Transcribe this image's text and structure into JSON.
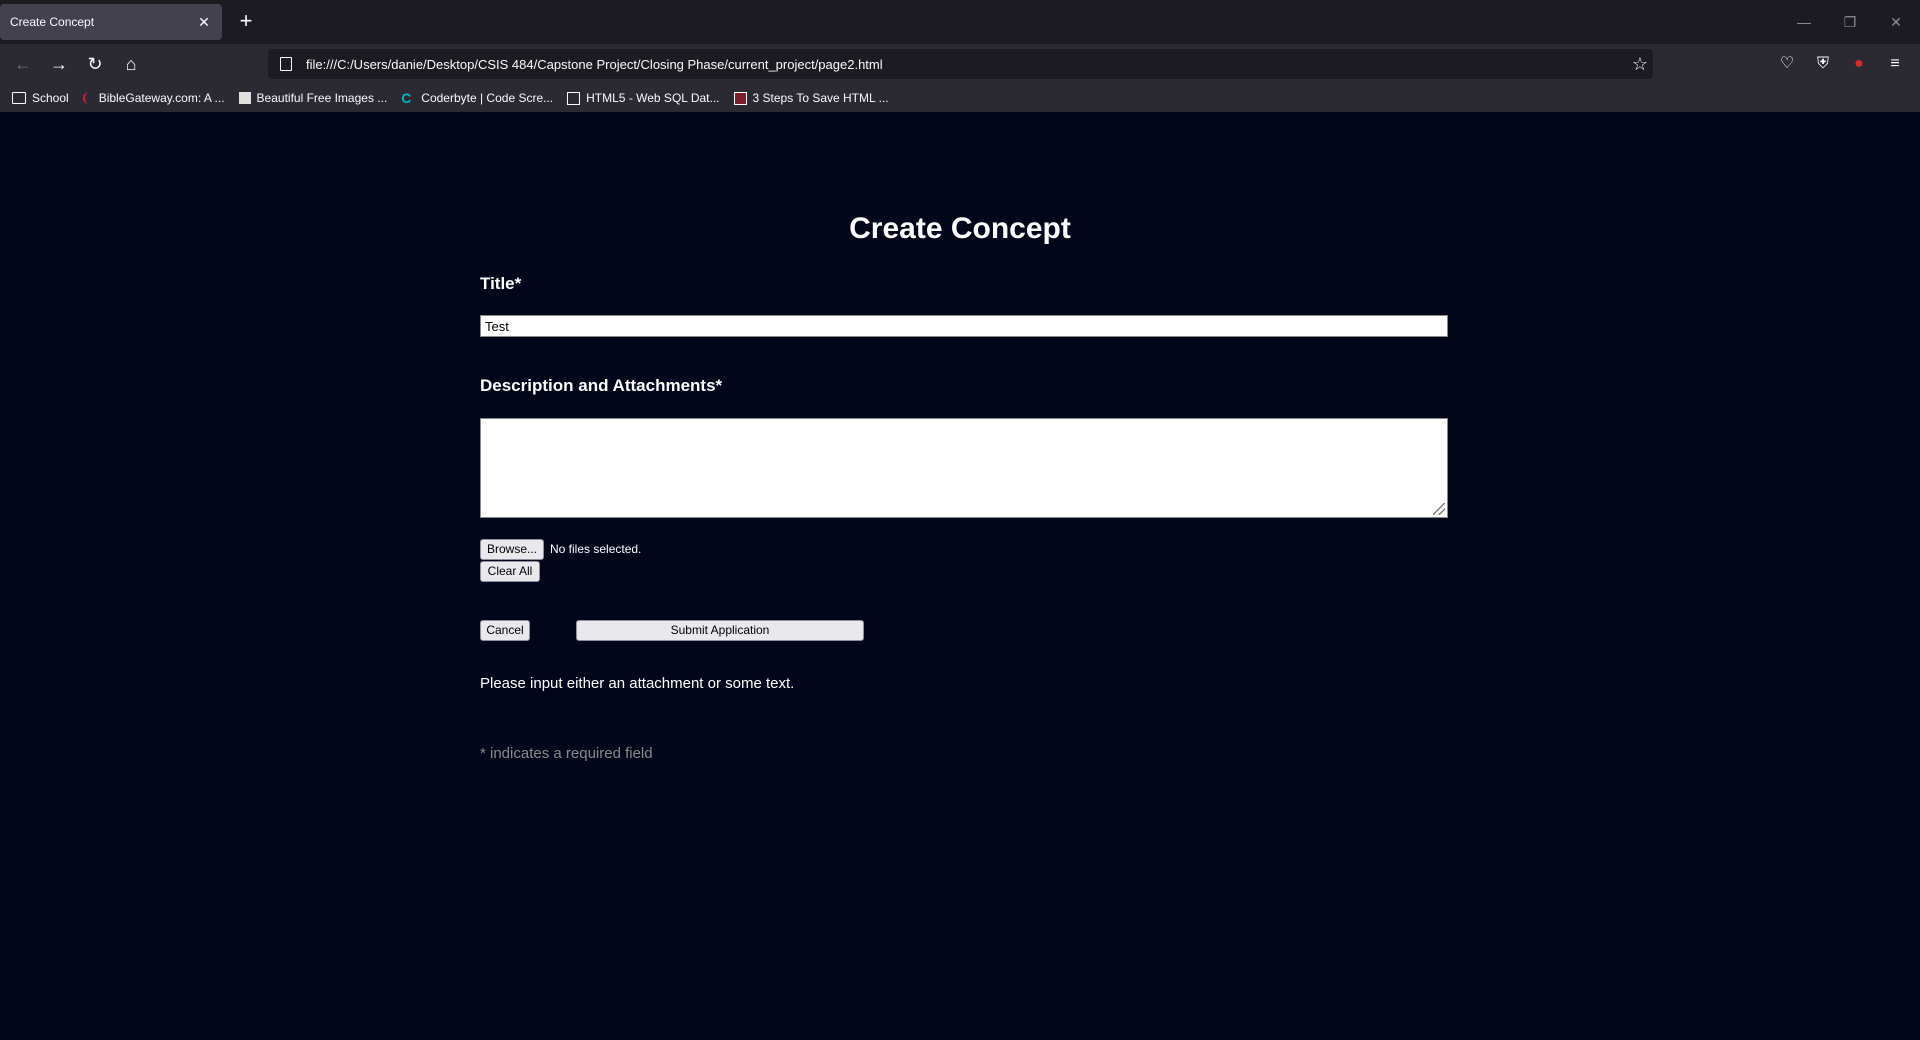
{
  "browser": {
    "tab_title": "Create Concept",
    "tab_close": "✕",
    "new_tab": "+",
    "url": "file:///C:/Users/danie/Desktop/CSIS 484/Capstone Project/Closing Phase/current_project/page2.html",
    "bookmarks": [
      {
        "label": "School",
        "icon": "folder-icon"
      },
      {
        "label": "BibleGateway.com: A ...",
        "icon": "biblegateway-favicon"
      },
      {
        "label": "Beautiful Free Images ...",
        "icon": "unsplash-favicon"
      },
      {
        "label": "Coderbyte | Code Scre...",
        "icon": "coderbyte-favicon"
      },
      {
        "label": "HTML5 - Web SQL Dat...",
        "icon": "tutorialspoint-favicon"
      },
      {
        "label": "3 Steps To Save HTML ...",
        "icon": "box-favicon"
      }
    ]
  },
  "form": {
    "heading": "Create Concept",
    "title_label": "Title*",
    "title_value": "Test",
    "description_label": "Description and Attachments*",
    "description_value": "",
    "browse_label": "Browse...",
    "file_status": "No files selected.",
    "clear_label": "Clear All",
    "cancel_label": "Cancel",
    "submit_label": "Submit Application",
    "message": "Please input either an attachment or some text.",
    "required_note": "* indicates a required field"
  }
}
